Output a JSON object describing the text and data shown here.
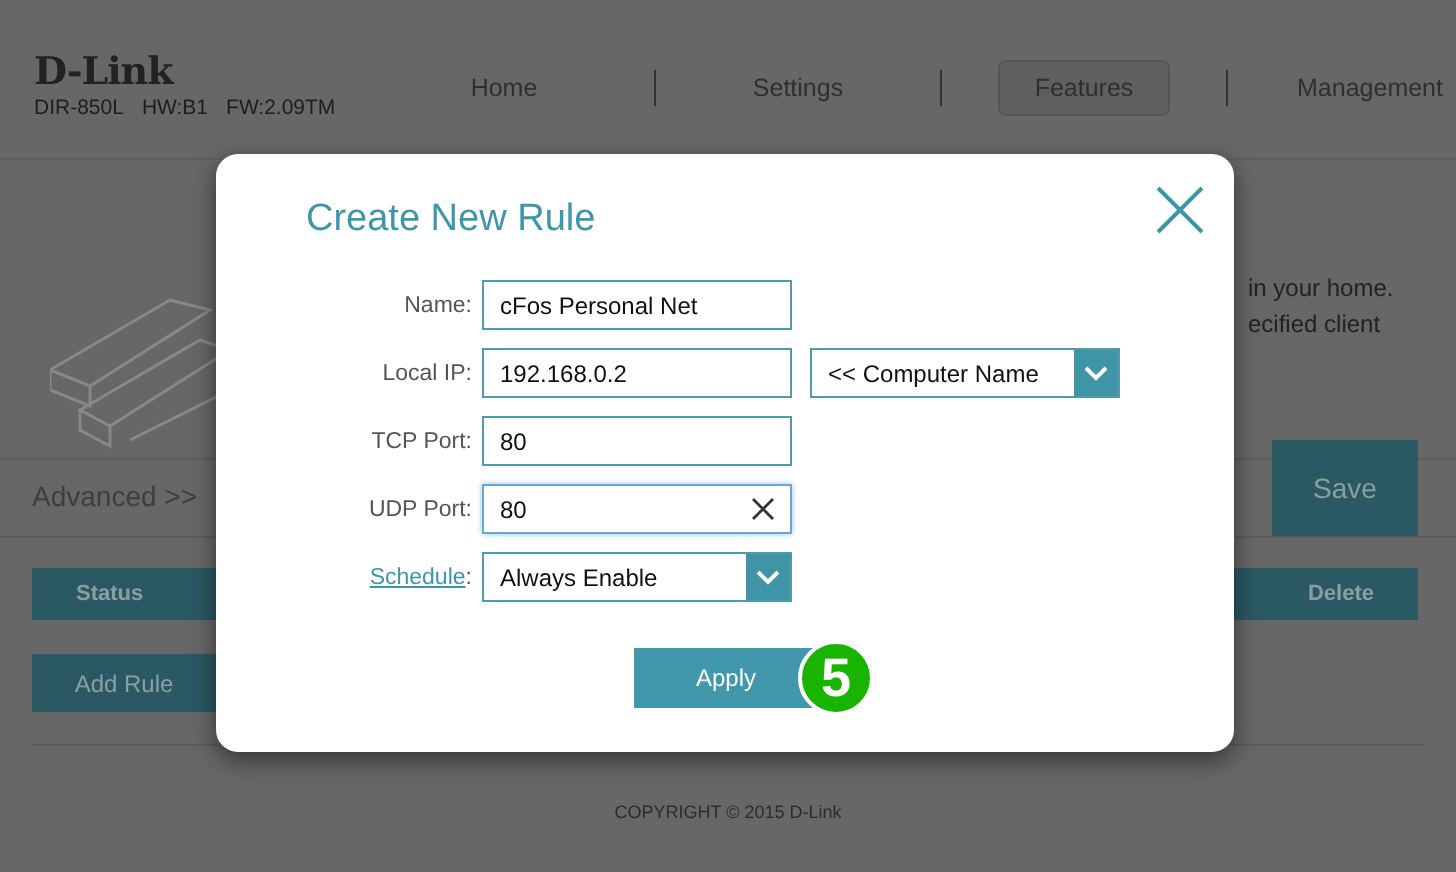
{
  "header": {
    "logo": "D-Link",
    "model": "DIR-850L",
    "hardware": "HW:B1",
    "firmware": "FW:2.09TM"
  },
  "nav": [
    {
      "label": "Home",
      "selected": false
    },
    {
      "label": "Settings",
      "selected": false
    },
    {
      "label": "Features",
      "selected": true
    },
    {
      "label": "Management",
      "selected": false
    }
  ],
  "intro_fragments": [
    "in your home.",
    "ecified client"
  ],
  "breadcrumb": "Advanced >>",
  "save_button": "Save",
  "table": {
    "columns": [
      "Status",
      "Delete"
    ]
  },
  "add_rule_button": "Add Rule",
  "footer": "COPYRIGHT © 2015 D-Link",
  "dialog": {
    "title": "Create New Rule",
    "fields": [
      {
        "kind": "text",
        "label": "Name:",
        "value": "cFos Personal Net"
      },
      {
        "kind": "text",
        "label": "Local IP:",
        "value": "192.168.0.2",
        "side_select": "<< Computer Name"
      },
      {
        "kind": "text",
        "label": "TCP Port:",
        "value": "80"
      },
      {
        "kind": "clearable",
        "label": "UDP Port:",
        "value": "80"
      },
      {
        "kind": "select",
        "label": "Schedule",
        "label_link": true,
        "label_suffix": ":",
        "value": "Always Enable"
      }
    ],
    "apply_button": "Apply",
    "step_badge": "5"
  }
}
